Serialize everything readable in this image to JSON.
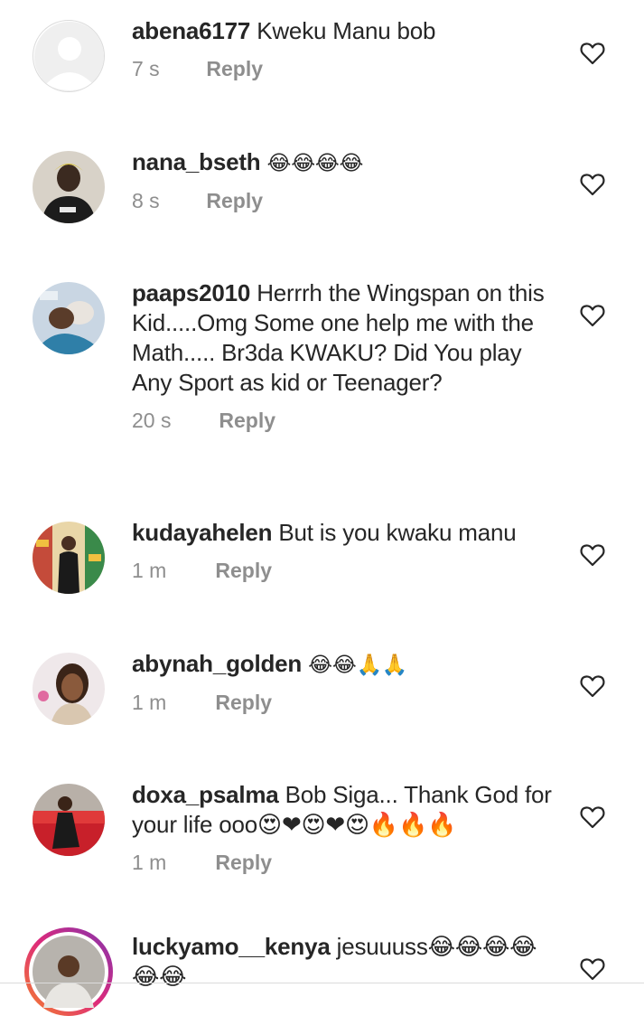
{
  "comments": [
    {
      "username": "abena6177",
      "text": "Kweku Manu bob",
      "time": "7 s",
      "reply": "Reply"
    },
    {
      "username": "nana_bseth",
      "text": "😂😂😂😂",
      "time": "8 s",
      "reply": "Reply"
    },
    {
      "username": "paaps2010",
      "text": "Herrrh the Wingspan on this Kid.....Omg Some one help me with the Math..... Br3da KWAKU? Did You play Any Sport as kid or Teenager?",
      "time": "20 s",
      "reply": "Reply"
    },
    {
      "username": "kudayahelen",
      "text": "But is you kwaku manu",
      "time": "1 m",
      "reply": "Reply"
    },
    {
      "username": "abynah_golden",
      "text": "😂😂🙏🙏",
      "time": "1 m",
      "reply": "Reply"
    },
    {
      "username": "doxa_psalma",
      "text": "Bob Siga... Thank God for your life ooo😍❤😍❤😍🔥🔥🔥",
      "time": "1 m",
      "reply": "Reply"
    },
    {
      "username": "luckyamo__kenya",
      "text": "jesuuuss😂😂😂😂😂😂",
      "time": "",
      "reply": ""
    }
  ],
  "colors": {
    "muted": "#8e8e8e",
    "text": "#262626",
    "story_ring": "#d6249f"
  },
  "icons": {
    "like": "heart-outline-icon",
    "avatar_placeholder": "default-avatar-icon"
  }
}
